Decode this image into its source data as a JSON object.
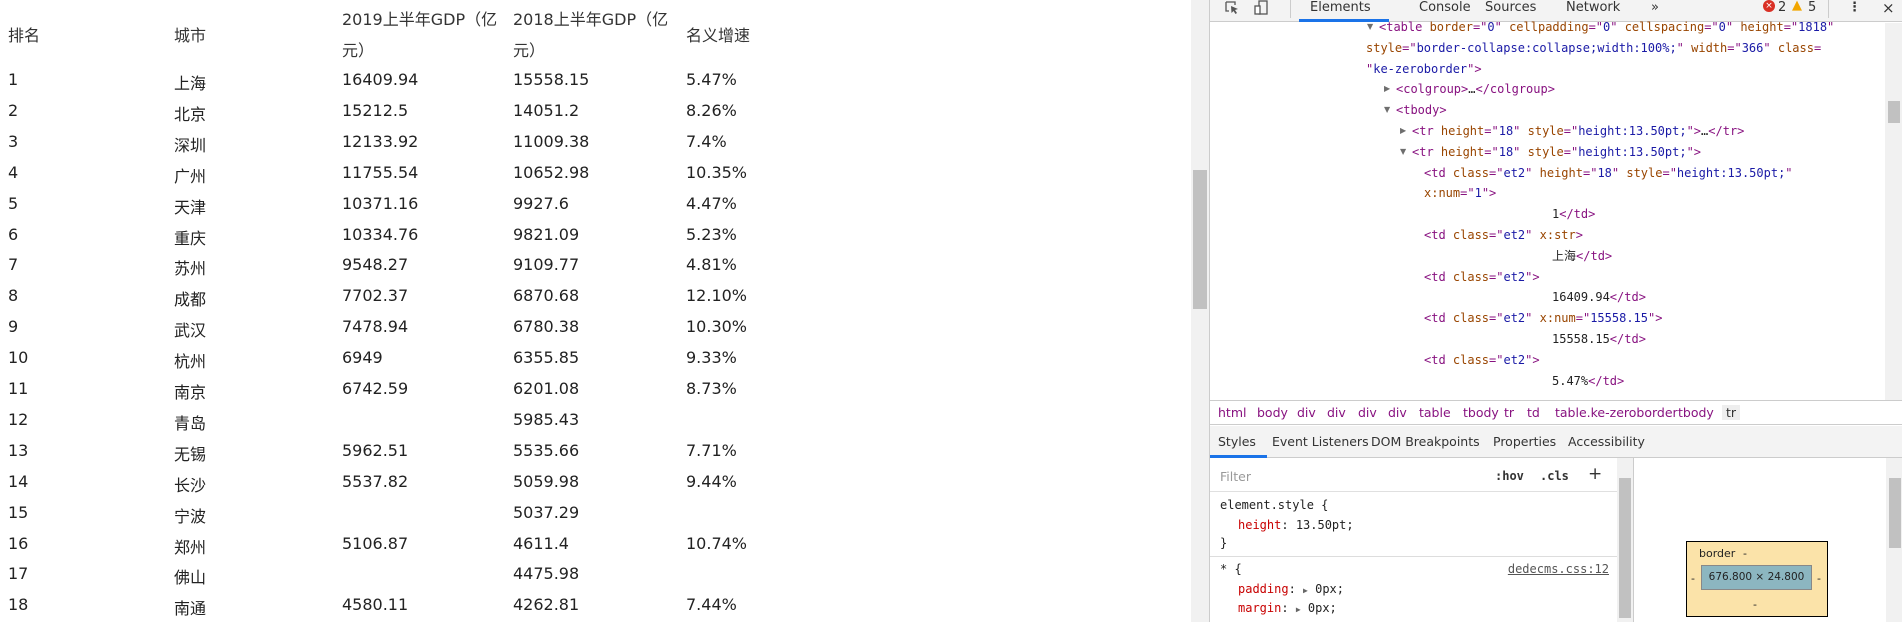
{
  "table": {
    "headers": [
      "排名",
      "城市",
      "2019上半年GDP（亿元）",
      "2018上半年GDP（亿元）",
      "名义增速"
    ],
    "header_lines": {
      "h2a": "2019上半年GDP（亿",
      "h2b": "元）",
      "h3a": "2018上半年GDP（亿",
      "h3b": "元）"
    },
    "rows": [
      [
        "1",
        "上海",
        "16409.94",
        "15558.15",
        "5.47%"
      ],
      [
        "2",
        "北京",
        "15212.5",
        "14051.2",
        "8.26%"
      ],
      [
        "3",
        "深圳",
        "12133.92",
        "11009.38",
        "7.4%"
      ],
      [
        "4",
        "广州",
        "11755.54",
        "10652.98",
        "10.35%"
      ],
      [
        "5",
        "天津",
        "10371.16",
        "9927.6",
        "4.47%"
      ],
      [
        "6",
        "重庆",
        "10334.76",
        "9821.09",
        "5.23%"
      ],
      [
        "7",
        "苏州",
        "9548.27",
        "9109.77",
        "4.81%"
      ],
      [
        "8",
        "成都",
        "7702.37",
        "6870.68",
        "12.10%"
      ],
      [
        "9",
        "武汉",
        "7478.94",
        "6780.38",
        "10.30%"
      ],
      [
        "10",
        "杭州",
        "6949",
        "6355.85",
        "9.33%"
      ],
      [
        "11",
        "南京",
        "6742.59",
        "6201.08",
        "8.73%"
      ],
      [
        "12",
        "青岛",
        "",
        "5985.43",
        ""
      ],
      [
        "13",
        "无锡",
        "5962.51",
        "5535.66",
        "7.71%"
      ],
      [
        "14",
        "长沙",
        "5537.82",
        "5059.98",
        "9.44%"
      ],
      [
        "15",
        "宁波",
        "",
        "5037.29",
        ""
      ],
      [
        "16",
        "郑州",
        "5106.87",
        "4611.4",
        "10.74%"
      ],
      [
        "17",
        "佛山",
        "",
        "4475.98",
        ""
      ],
      [
        "18",
        "南通",
        "4580.11",
        "4262.81",
        "7.44%"
      ]
    ]
  },
  "devtools": {
    "tabs": [
      "Elements",
      "Console",
      "Sources",
      "Network"
    ],
    "more_tabs": "»",
    "errors": "2",
    "warnings": "5",
    "accent": "#1a73e8",
    "dom_lines": [
      [
        [
          "tg",
          "<table "
        ],
        [
          "an",
          "border"
        ],
        [
          "tg",
          "=\""
        ],
        [
          "av",
          "0"
        ],
        [
          "tg",
          "\" "
        ],
        [
          "an",
          "cellpadding"
        ],
        [
          "tg",
          "=\""
        ],
        [
          "av",
          "0"
        ],
        [
          "tg",
          "\" "
        ],
        [
          "an",
          "cellspacing"
        ],
        [
          "tg",
          "=\""
        ],
        [
          "av",
          "0"
        ],
        [
          "tg",
          "\" "
        ],
        [
          "an",
          "height"
        ],
        [
          "tg",
          "=\""
        ],
        [
          "av",
          "1818"
        ],
        [
          "tg",
          "\""
        ]
      ],
      [
        [
          "an",
          "style"
        ],
        [
          "tg",
          "=\""
        ],
        [
          "av",
          "border-collapse:collapse;width:100%;"
        ],
        [
          "tg",
          "\" "
        ],
        [
          "an",
          "width"
        ],
        [
          "tg",
          "=\""
        ],
        [
          "av",
          "366"
        ],
        [
          "tg",
          "\" "
        ],
        [
          "an",
          "class"
        ],
        [
          "tg",
          "="
        ]
      ],
      [
        [
          "tg",
          "\""
        ],
        [
          "av",
          "ke-zeroborder"
        ],
        [
          "tg",
          "\">"
        ]
      ],
      [
        [
          "tg",
          "<colgroup>"
        ],
        [
          "tx",
          "…"
        ],
        [
          "tg",
          "</colgroup>"
        ]
      ],
      [
        [
          "tg",
          "<tbody>"
        ]
      ],
      [
        [
          "tg",
          "<tr "
        ],
        [
          "an",
          "height"
        ],
        [
          "tg",
          "=\""
        ],
        [
          "av",
          "18"
        ],
        [
          "tg",
          "\" "
        ],
        [
          "an",
          "style"
        ],
        [
          "tg",
          "=\""
        ],
        [
          "av",
          "height:13.50pt;"
        ],
        [
          "tg",
          "\">"
        ],
        [
          "tx",
          "…"
        ],
        [
          "tg",
          "</tr>"
        ]
      ],
      [
        [
          "tg",
          "<tr "
        ],
        [
          "an",
          "height"
        ],
        [
          "tg",
          "=\""
        ],
        [
          "av",
          "18"
        ],
        [
          "tg",
          "\" "
        ],
        [
          "an",
          "style"
        ],
        [
          "tg",
          "=\""
        ],
        [
          "av",
          "height:13.50pt;"
        ],
        [
          "tg",
          "\">"
        ]
      ],
      [
        [
          "tg",
          "<td "
        ],
        [
          "an",
          "class"
        ],
        [
          "tg",
          "=\""
        ],
        [
          "av",
          "et2"
        ],
        [
          "tg",
          "\" "
        ],
        [
          "an",
          "height"
        ],
        [
          "tg",
          "=\""
        ],
        [
          "av",
          "18"
        ],
        [
          "tg",
          "\" "
        ],
        [
          "an",
          "style"
        ],
        [
          "tg",
          "=\""
        ],
        [
          "av",
          "height:13.50pt;"
        ],
        [
          "tg",
          "\""
        ]
      ],
      [
        [
          "an",
          "x:num"
        ],
        [
          "tg",
          "=\""
        ],
        [
          "av",
          "1"
        ],
        [
          "tg",
          "\">"
        ]
      ],
      [
        [
          "tx",
          "1"
        ],
        [
          "tg",
          "</td>"
        ]
      ],
      [
        [
          "tg",
          "<td "
        ],
        [
          "an",
          "class"
        ],
        [
          "tg",
          "=\""
        ],
        [
          "av",
          "et2"
        ],
        [
          "tg",
          "\" "
        ],
        [
          "an",
          "x:str"
        ],
        [
          "tg",
          ">"
        ]
      ],
      [
        [
          "tx",
          "上海"
        ],
        [
          "tg",
          "</td>"
        ]
      ],
      [
        [
          "tg",
          "<td "
        ],
        [
          "an",
          "class"
        ],
        [
          "tg",
          "=\""
        ],
        [
          "av",
          "et2"
        ],
        [
          "tg",
          "\">"
        ]
      ],
      [
        [
          "tx",
          "16409.94"
        ],
        [
          "tg",
          "</td>"
        ]
      ],
      [
        [
          "tg",
          "<td "
        ],
        [
          "an",
          "class"
        ],
        [
          "tg",
          "=\""
        ],
        [
          "av",
          "et2"
        ],
        [
          "tg",
          "\" "
        ],
        [
          "an",
          "x:num"
        ],
        [
          "tg",
          "=\""
        ],
        [
          "av",
          "15558.15"
        ],
        [
          "tg",
          "\">"
        ]
      ],
      [
        [
          "tx",
          "15558.15"
        ],
        [
          "tg",
          "</td>"
        ]
      ],
      [
        [
          "tg",
          "<td "
        ],
        [
          "an",
          "class"
        ],
        [
          "tg",
          "=\""
        ],
        [
          "av",
          "et2"
        ],
        [
          "tg",
          "\">"
        ]
      ],
      [
        [
          "tx",
          "5.47%"
        ],
        [
          "tg",
          "</td>"
        ]
      ]
    ],
    "breadcrumbs": [
      "html",
      "body",
      "div",
      "div",
      "div",
      "div",
      "table",
      "tbody",
      "tr",
      "td",
      "table.ke-zeroborder",
      "tbody",
      "tr"
    ],
    "subtabs": [
      "Styles",
      "Event Listeners",
      "DOM Breakpoints",
      "Properties",
      "Accessibility"
    ],
    "styles": {
      "filter_placeholder": "Filter",
      "hov": ":hov",
      "cls": ".cls",
      "plus": "+",
      "rule1_selector": "element.style {",
      "rule1_prop": "height",
      "rule1_val": "13.50pt;",
      "close": "}",
      "rule2_selector": "* {",
      "rule2_source": "dedecms.css:12",
      "rule2_prop1": "padding",
      "rule2_val1": "0px;",
      "rule2_prop2": "margin",
      "rule2_val2": "0px;"
    },
    "box_model": {
      "label": "border",
      "dash": "-",
      "content": "676.800 × 24.800"
    }
  }
}
